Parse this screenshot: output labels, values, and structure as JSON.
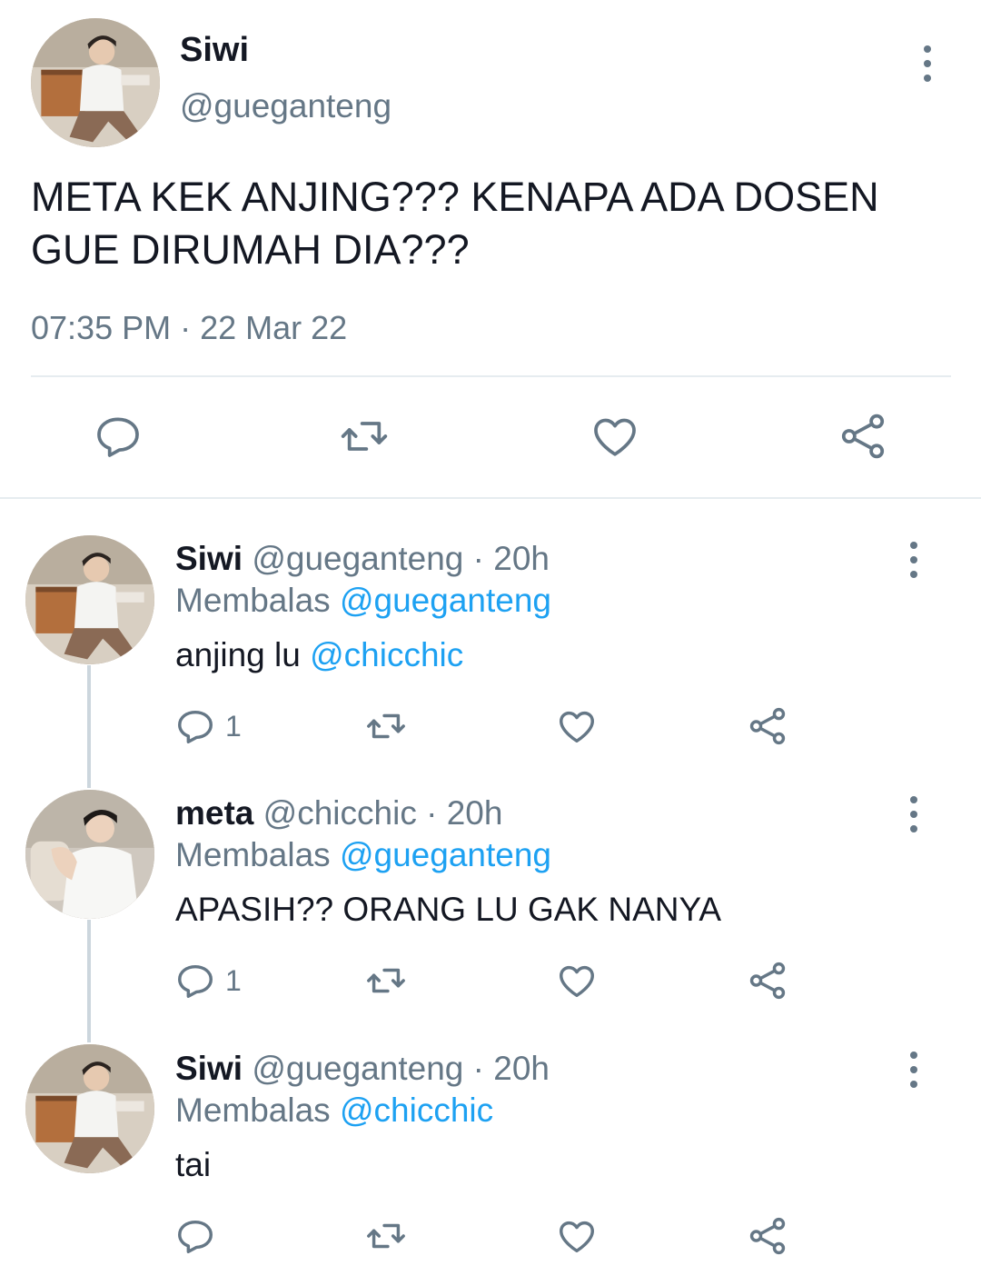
{
  "main_tweet": {
    "name": "Siwi",
    "handle": "@gueganteng",
    "text": "META KEK ANJING??? KENAPA ADA DOSEN GUE DIRUMAH DIA???",
    "timestamp": "07:35 PM · 22 Mar 22",
    "actions": [
      "reply-icon",
      "retweet-icon",
      "like-icon",
      "share-icon"
    ]
  },
  "replies": [
    {
      "name": "Siwi",
      "handle": "@gueganteng",
      "time": "· 20h",
      "replying_label": "Membalas",
      "replying_to": "@gueganteng",
      "text": "anjing lu ",
      "text_mention": "@chicchic",
      "reply_count": "1"
    },
    {
      "name": "meta",
      "handle": "@chicchic",
      "time": "· 20h",
      "replying_label": "Membalas",
      "replying_to": "@gueganteng",
      "text": "APASIH?? ORANG LU GAK NANYA",
      "text_mention": "",
      "reply_count": "1"
    },
    {
      "name": "Siwi",
      "handle": "@gueganteng",
      "time": "· 20h",
      "replying_label": "Membalas",
      "replying_to": "@chicchic",
      "text": "tai",
      "text_mention": "",
      "reply_count": ""
    }
  ],
  "colors": {
    "text": "#141823",
    "secondary": "#657786",
    "mention": "#1da1f2",
    "divider": "#e6ecf0"
  }
}
